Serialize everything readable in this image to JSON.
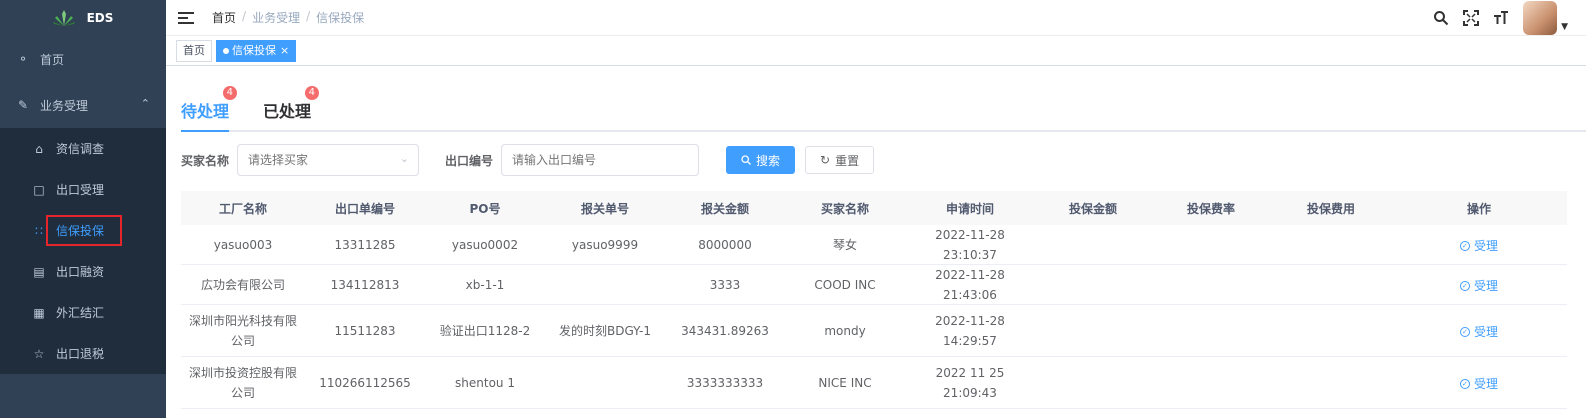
{
  "app": {
    "logo_text": "EDS"
  },
  "sidebar": {
    "items": [
      {
        "label": "首页",
        "icon": "dashboard-icon"
      },
      {
        "label": "业务受理",
        "icon": "edit-icon",
        "expanded": true
      }
    ],
    "submenu": [
      {
        "label": "资信调查",
        "icon": "home-icon"
      },
      {
        "label": "出口受理",
        "icon": "book-icon"
      },
      {
        "label": "信保投保",
        "icon": "grid-icon",
        "active": true
      },
      {
        "label": "出口融资",
        "icon": "money-icon"
      },
      {
        "label": "外汇结汇",
        "icon": "doc-icon"
      },
      {
        "label": "出口退税",
        "icon": "star-icon"
      }
    ]
  },
  "navbar": {
    "breadcrumb": [
      "首页",
      "业务受理",
      "信保投保"
    ],
    "breadcrumb_sep": "/"
  },
  "tags": [
    {
      "label": "首页",
      "active": false
    },
    {
      "label": "信保投保",
      "active": true
    }
  ],
  "tabs": [
    {
      "label": "待处理",
      "badge": "4",
      "active": true
    },
    {
      "label": "已处理",
      "badge": "4",
      "active": false
    }
  ],
  "filters": {
    "buyer_label": "买家名称",
    "buyer_placeholder": "请选择买家",
    "export_label": "出口编号",
    "export_placeholder": "请输入出口编号",
    "search_label": "搜索",
    "reset_label": "重置"
  },
  "table": {
    "columns": [
      "工厂名称",
      "出口单编号",
      "PO号",
      "报关单号",
      "报关金额",
      "买家名称",
      "申请时间",
      "投保金额",
      "投保费率",
      "投保费用",
      "操作"
    ],
    "rows": [
      {
        "factory": "yasuo003",
        "export_no": "13311285",
        "po": "yasuo0002",
        "customs_no": "yasuo9999",
        "customs_amount": "8000000",
        "buyer": "琴女",
        "apply_time": "2022-11-28 23:10:37",
        "insured_amount": "",
        "rate": "",
        "fee": "",
        "action": "受理"
      },
      {
        "factory": "広功会有限公司",
        "export_no": "134112813",
        "po": "xb-1-1",
        "customs_no": "",
        "customs_amount": "3333",
        "buyer": "COOD INC",
        "apply_time": "2022-11-28 21:43:06",
        "insured_amount": "",
        "rate": "",
        "fee": "",
        "action": "受理"
      },
      {
        "factory": "深圳市阳光科技有限公司",
        "export_no": "11511283",
        "po": "验证出口1128-2",
        "customs_no": "发的时刻BDGY-1",
        "customs_amount": "343431.89263",
        "buyer": "mondy",
        "apply_time": "2022-11-28 14:29:57",
        "insured_amount": "",
        "rate": "",
        "fee": "",
        "action": "受理"
      },
      {
        "factory": "深圳市投资控股有限公司",
        "export_no": "110266112565",
        "po": "shentou 1",
        "customs_no": "",
        "customs_amount": "3333333333",
        "buyer": "NICE INC",
        "apply_time": "2022 11 25 21:09:43",
        "insured_amount": "",
        "rate": "",
        "fee": "",
        "action": "受理"
      }
    ]
  },
  "colors": {
    "sidebar_bg": "#304156",
    "submenu_bg": "#1f2d3d",
    "primary": "#409eff",
    "badge": "#f56c6c",
    "highlight": "#e4262c"
  }
}
